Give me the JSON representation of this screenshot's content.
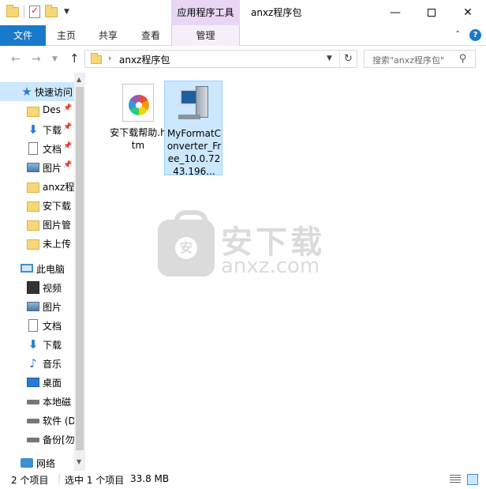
{
  "window": {
    "title": "anxz程序包",
    "contextual_tab_group": "应用程序工具",
    "minimize": "—",
    "close": "✕"
  },
  "ribbon": {
    "file": "文件",
    "home": "主页",
    "share": "共享",
    "view": "查看",
    "manage": "管理",
    "help": "?",
    "collapse": "⌃"
  },
  "address": {
    "path": "anxz程序包",
    "separator": "›",
    "search_placeholder": "搜索\"anxz程序包\"",
    "back": "←",
    "forward": "→",
    "recent": "⌄",
    "up": "↑",
    "refresh": "↻",
    "search_icon": "⚲"
  },
  "nav": {
    "quick_access": "快速访问",
    "items": [
      {
        "label": "Des",
        "icon": "folder-icon",
        "pinned": true
      },
      {
        "label": "下载",
        "icon": "download-icon",
        "pinned": true
      },
      {
        "label": "文档",
        "icon": "document-icon",
        "pinned": true
      },
      {
        "label": "图片",
        "icon": "picture-icon",
        "pinned": true
      },
      {
        "label": "anxz程",
        "icon": "folder-icon",
        "pinned": false
      },
      {
        "label": "安下载",
        "icon": "folder-icon",
        "pinned": false
      },
      {
        "label": "图片管",
        "icon": "folder-icon",
        "pinned": false
      },
      {
        "label": "未上传",
        "icon": "folder-icon",
        "pinned": false
      }
    ],
    "this_pc": "此电脑",
    "pc_items": [
      {
        "label": "视频",
        "icon": "video-icon"
      },
      {
        "label": "图片",
        "icon": "picture-icon"
      },
      {
        "label": "文档",
        "icon": "document-icon"
      },
      {
        "label": "下载",
        "icon": "download-icon"
      },
      {
        "label": "音乐",
        "icon": "music-icon"
      },
      {
        "label": "桌面",
        "icon": "desktop-icon"
      },
      {
        "label": "本地磁",
        "icon": "local-disk-icon"
      },
      {
        "label": "软件 (D",
        "icon": "drive-icon"
      },
      {
        "label": "备份[勿",
        "icon": "drive-icon"
      }
    ],
    "network": "网络",
    "pin_glyph": "📌"
  },
  "files": [
    {
      "name": "安下载帮助.htm",
      "icon": "html-file-icon",
      "selected": false
    },
    {
      "name": "MyFormatConverter_Free_10.0.7243.196...",
      "icon": "installer-icon",
      "selected": true
    }
  ],
  "watermark": {
    "cn": "安下载",
    "en": "anxz.com",
    "badge": "安"
  },
  "status": {
    "item_count": "2 个项目",
    "selection": "选中 1 个项目",
    "size": "33.8 MB",
    "separator": "|"
  }
}
